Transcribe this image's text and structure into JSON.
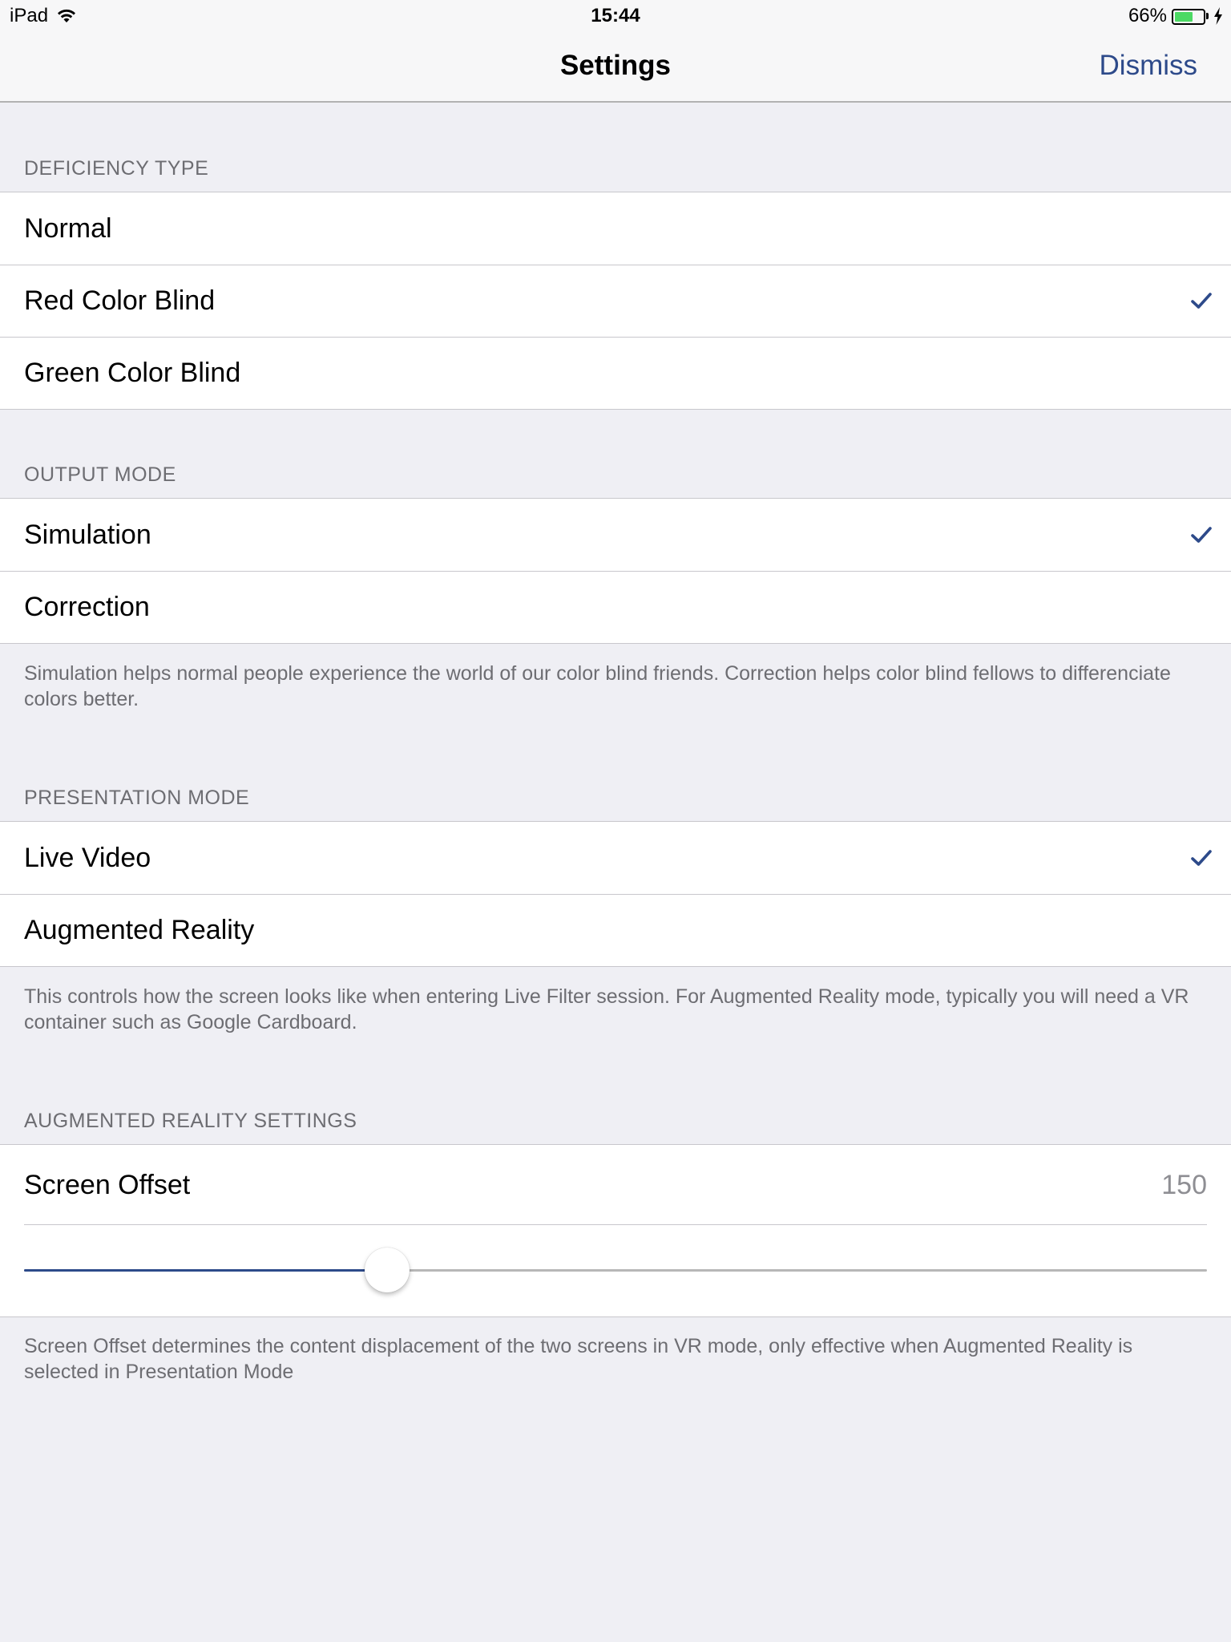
{
  "status_bar": {
    "device": "iPad",
    "time": "15:44",
    "battery_percent": "66%",
    "battery_level": 0.66,
    "battery_color": "#4cd964"
  },
  "nav": {
    "title": "Settings",
    "dismiss_label": "Dismiss",
    "accent_color": "#2d4a8a"
  },
  "deficiency": {
    "header": "DEFICIENCY TYPE",
    "items": [
      {
        "label": "Normal",
        "selected": false
      },
      {
        "label": "Red Color Blind",
        "selected": true
      },
      {
        "label": "Green Color Blind",
        "selected": false
      }
    ]
  },
  "output": {
    "header": "OUTPUT MODE",
    "items": [
      {
        "label": "Simulation",
        "selected": true
      },
      {
        "label": "Correction",
        "selected": false
      }
    ],
    "footer": "Simulation helps normal people experience the world of our color blind friends. Correction helps color blind fellows to differenciate colors better."
  },
  "presentation": {
    "header": "PRESENTATION MODE",
    "items": [
      {
        "label": "Live Video",
        "selected": true
      },
      {
        "label": "Augmented Reality",
        "selected": false
      }
    ],
    "footer": "This controls how the screen looks like when entering Live Filter session. For Augmented Reality mode, typically you will need a VR container such as Google Cardboard."
  },
  "ar_settings": {
    "header": "AUGMENTED REALITY SETTINGS",
    "offset_label": "Screen Offset",
    "offset_value": "150",
    "slider_fraction": 0.307,
    "footer": "Screen Offset determines the content displacement of the two screens in VR mode, only effective when Augmented Reality is selected in Presentation Mode"
  }
}
